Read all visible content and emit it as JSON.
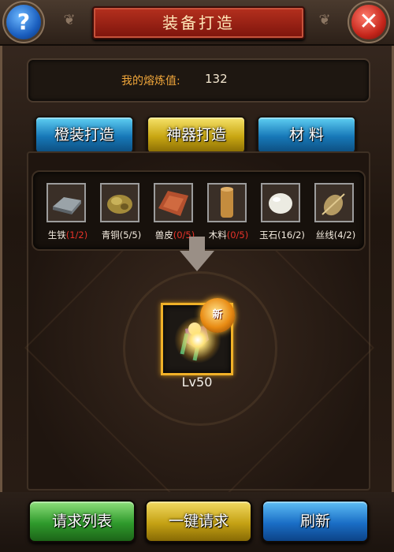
{
  "header": {
    "title": "装备打造",
    "help_icon": "?",
    "close_icon": "✕"
  },
  "smelt": {
    "label": "我的熔炼值:",
    "value": "132"
  },
  "tabs": [
    {
      "label": "橙装打造",
      "color": "#1778b8"
    },
    {
      "label": "神器打造",
      "color": "#c9a712"
    },
    {
      "label": "材 料",
      "color": "#1778b8"
    }
  ],
  "materials": [
    {
      "name": "生铁",
      "count": "(1/2)",
      "count_red": true,
      "icon": "iron-ingot-icon"
    },
    {
      "name": "青铜",
      "count": "(5/5)",
      "count_red": false,
      "icon": "bronze-ore-icon"
    },
    {
      "name": "兽皮",
      "count": "(0/5)",
      "count_red": true,
      "icon": "hide-icon"
    },
    {
      "name": "木料",
      "count": "(0/5)",
      "count_red": true,
      "icon": "wood-log-icon"
    },
    {
      "name": "玉石",
      "count": "(16/2)",
      "count_red": false,
      "icon": "jade-stone-icon"
    },
    {
      "name": "丝线",
      "count": "(4/2)",
      "count_red": false,
      "icon": "silk-thread-icon"
    }
  ],
  "result": {
    "badge": "新",
    "level": "Lv50",
    "icon": "artifact-item-icon"
  },
  "buttons": {
    "request_list": "请求列表",
    "one_click_request": "一键请求",
    "refresh": "刷新"
  }
}
